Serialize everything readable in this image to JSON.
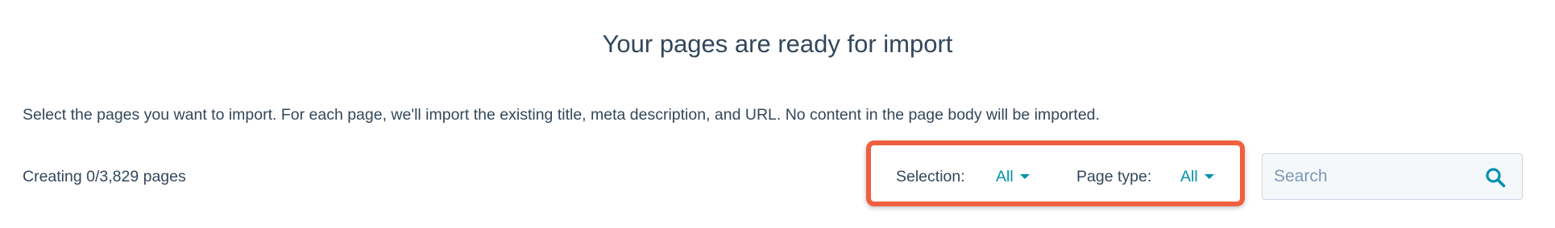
{
  "header": {
    "title": "Your pages are ready for import"
  },
  "instructions": "Select the pages you want to import. For each page, we'll import the existing title, meta description, and URL. No content in the page body will be imported.",
  "progress": {
    "text": "Creating 0/3,829 pages",
    "created": 0,
    "total": 3829
  },
  "filters": {
    "selection": {
      "label": "Selection:",
      "value": "All"
    },
    "page_type": {
      "label": "Page type:",
      "value": "All"
    }
  },
  "search": {
    "placeholder": "Search",
    "value": "",
    "icon": "search-icon"
  },
  "colors": {
    "text": "#33475b",
    "link": "#0091ae",
    "highlight": "#f05f3e",
    "search_bg": "#f5f8fa",
    "search_border": "#cbd6e2",
    "placeholder": "#7c98b6"
  }
}
